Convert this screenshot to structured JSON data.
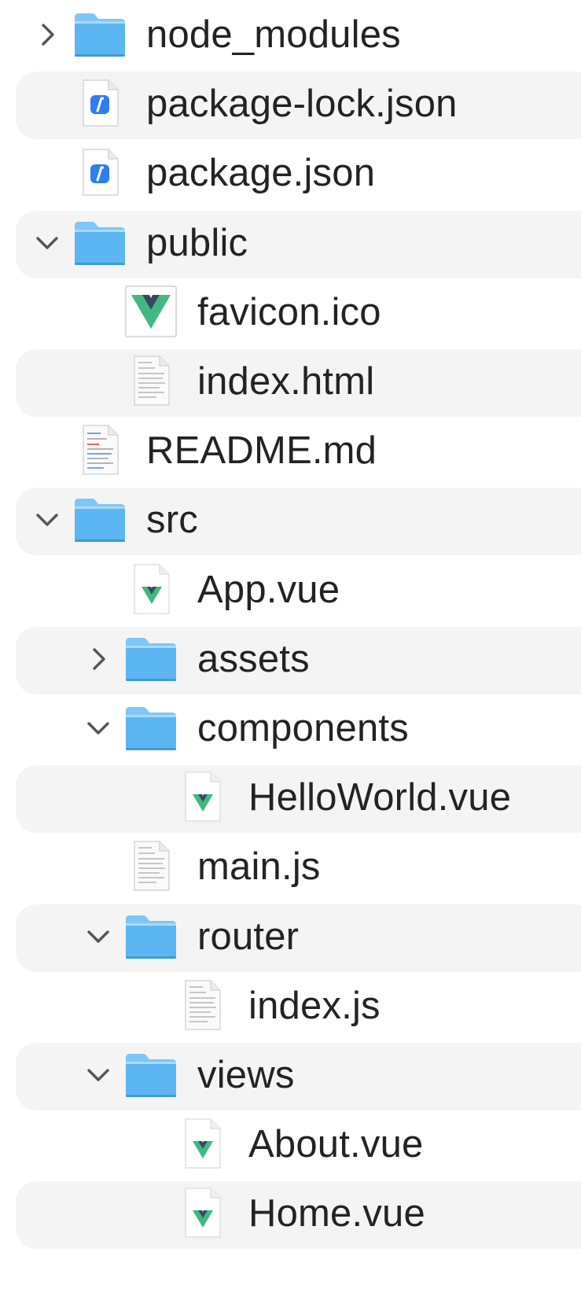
{
  "colors": {
    "folder_top": "#7ec6f6",
    "folder_body": "#5bb6f2",
    "vue_green": "#41b883",
    "vue_dark": "#34495e",
    "row_alt": "#f4f4f4",
    "text": "#232323"
  },
  "file_tree": [
    {
      "name": "node_modules",
      "depth": 0,
      "kind": "folder",
      "disclosure": "collapsed",
      "icon": "folder-icon"
    },
    {
      "name": "package-lock.json",
      "depth": 0,
      "kind": "file",
      "disclosure": "none",
      "icon": "json-file-icon"
    },
    {
      "name": "package.json",
      "depth": 0,
      "kind": "file",
      "disclosure": "none",
      "icon": "json-file-icon"
    },
    {
      "name": "public",
      "depth": 0,
      "kind": "folder",
      "disclosure": "expanded",
      "icon": "folder-icon"
    },
    {
      "name": "favicon.ico",
      "depth": 1,
      "kind": "file",
      "disclosure": "none",
      "icon": "vue-logo-icon"
    },
    {
      "name": "index.html",
      "depth": 1,
      "kind": "file",
      "disclosure": "none",
      "icon": "text-file-icon"
    },
    {
      "name": "README.md",
      "depth": 0,
      "kind": "file",
      "disclosure": "none",
      "icon": "markdown-file-icon"
    },
    {
      "name": "src",
      "depth": 0,
      "kind": "folder",
      "disclosure": "expanded",
      "icon": "folder-icon"
    },
    {
      "name": "App.vue",
      "depth": 1,
      "kind": "file",
      "disclosure": "none",
      "icon": "vue-file-icon"
    },
    {
      "name": "assets",
      "depth": 1,
      "kind": "folder",
      "disclosure": "collapsed",
      "icon": "folder-icon"
    },
    {
      "name": "components",
      "depth": 1,
      "kind": "folder",
      "disclosure": "expanded",
      "icon": "folder-icon"
    },
    {
      "name": "HelloWorld.vue",
      "depth": 2,
      "kind": "file",
      "disclosure": "none",
      "icon": "vue-file-icon"
    },
    {
      "name": "main.js",
      "depth": 1,
      "kind": "file",
      "disclosure": "none",
      "icon": "text-file-icon"
    },
    {
      "name": "router",
      "depth": 1,
      "kind": "folder",
      "disclosure": "expanded",
      "icon": "folder-icon"
    },
    {
      "name": "index.js",
      "depth": 2,
      "kind": "file",
      "disclosure": "none",
      "icon": "text-file-icon"
    },
    {
      "name": "views",
      "depth": 1,
      "kind": "folder",
      "disclosure": "expanded",
      "icon": "folder-icon"
    },
    {
      "name": "About.vue",
      "depth": 2,
      "kind": "file",
      "disclosure": "none",
      "icon": "vue-file-icon"
    },
    {
      "name": "Home.vue",
      "depth": 2,
      "kind": "file",
      "disclosure": "none",
      "icon": "vue-file-icon"
    }
  ]
}
